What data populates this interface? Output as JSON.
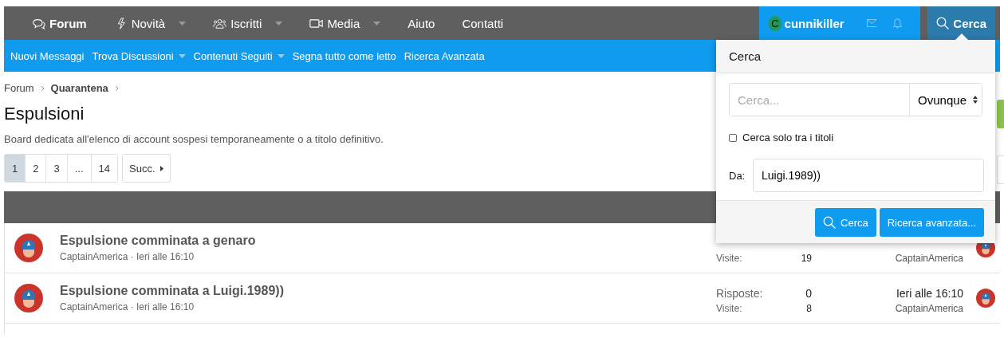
{
  "nav": {
    "items": [
      {
        "label": "Forum",
        "kind": "chat",
        "dropdown": false,
        "selected": true
      },
      {
        "label": "Novità",
        "kind": "bolt",
        "dropdown": true,
        "selected": false
      },
      {
        "label": "Iscritti",
        "kind": "users",
        "dropdown": true,
        "selected": false
      },
      {
        "label": "Media",
        "kind": "video",
        "dropdown": true,
        "selected": false
      },
      {
        "label": "Aiuto",
        "kind": "text",
        "dropdown": false,
        "selected": false
      },
      {
        "label": "Contatti",
        "kind": "text",
        "dropdown": false,
        "selected": false
      }
    ],
    "user": {
      "initial": "C",
      "name": "cunnikiller"
    },
    "search_button": "Cerca"
  },
  "subnav": [
    {
      "label": "Nuovi Messaggi",
      "dropdown": false
    },
    {
      "label": "Trova Discussioni",
      "dropdown": true
    },
    {
      "label": "Contenuti Seguiti",
      "dropdown": true
    },
    {
      "label": "Segna tutto come letto",
      "dropdown": false
    },
    {
      "label": "Ricerca Avanzata",
      "dropdown": false
    }
  ],
  "breadcrumb": [
    {
      "label": "Forum",
      "current": false
    },
    {
      "label": "Quarantena",
      "current": true
    }
  ],
  "title": "Espulsioni",
  "description": "Board dedicata all'elenco di account sospesi temporaneamente o a titolo definitivo.",
  "pagination": {
    "pages": [
      {
        "label": "1",
        "selected": true
      },
      {
        "label": "2",
        "selected": false
      },
      {
        "label": "3",
        "selected": false
      },
      {
        "label": "...",
        "selected": false
      },
      {
        "label": "14",
        "selected": false
      }
    ],
    "next": "Succ."
  },
  "threads": [
    {
      "title": "Espulsione comminata a genaro",
      "meta": "CaptainAmerica · Ieri alle 16:10",
      "visits_label": "Visite:",
      "visits": "19",
      "last_poster": "CaptainAmerica"
    },
    {
      "title": "Espulsione comminata a Luigi.1989))",
      "meta": "CaptainAmerica · Ieri alle 16:10",
      "replies_label": "Risposte:",
      "replies": "0",
      "visits_label": "Visite:",
      "visits": "8",
      "last_date": "Ieri alle 16:10",
      "last_poster": "CaptainAmerica"
    }
  ],
  "search_popup": {
    "title": "Cerca",
    "placeholder": "Cerca...",
    "scope": "Ovunque",
    "titles_only": {
      "label": "Cerca solo tra i titoli",
      "checked": false
    },
    "from_label": "Da:",
    "from_value": "Luigi.1989))",
    "buttons": [
      {
        "label": "Cerca",
        "kind": "search"
      },
      {
        "label": "Ricerca avanzata...",
        "kind": "plain"
      }
    ]
  }
}
